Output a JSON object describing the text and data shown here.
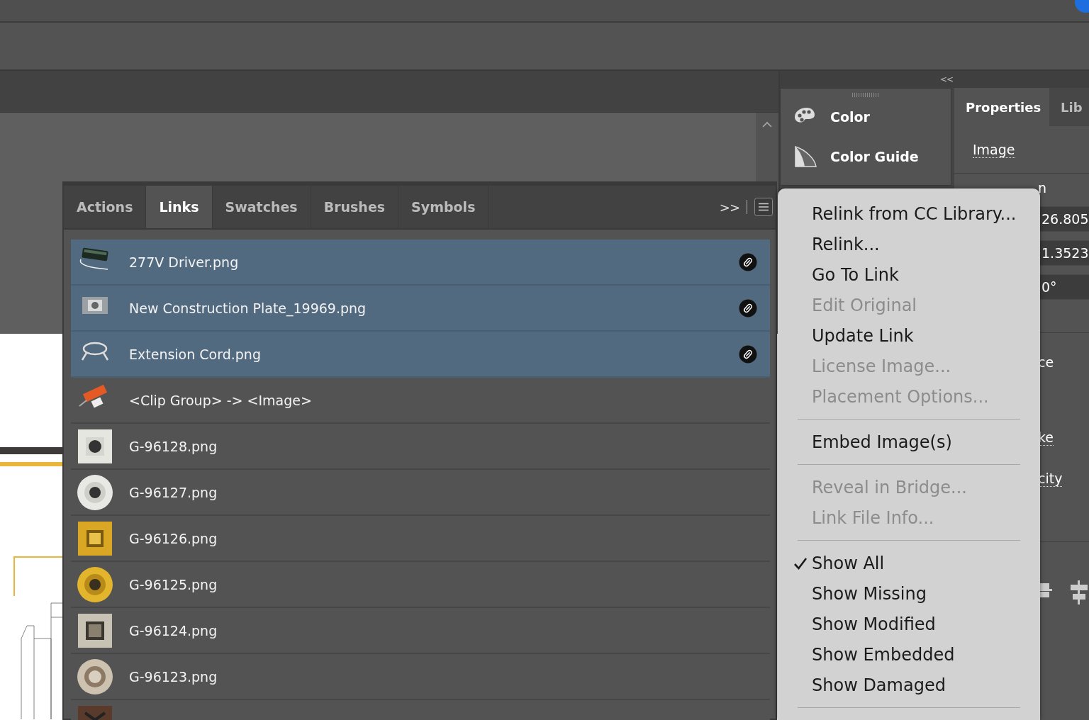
{
  "dock": {
    "collapse_label": "<<",
    "panels": [
      {
        "label": "Color"
      },
      {
        "label": "Color Guide"
      }
    ]
  },
  "properties": {
    "tabs": [
      {
        "label": "Properties",
        "selected": true
      },
      {
        "label": "Lib",
        "selected": false
      }
    ],
    "heading": "Image",
    "label_1": "n",
    "fields": [
      "26.805",
      "1.3523",
      "0°"
    ],
    "labels": [
      "ce",
      "ke",
      "city"
    ]
  },
  "links_panel": {
    "tabs": [
      {
        "label": "Actions",
        "selected": false
      },
      {
        "label": "Links",
        "selected": true
      },
      {
        "label": "Swatches",
        "selected": false
      },
      {
        "label": "Brushes",
        "selected": false
      },
      {
        "label": "Symbols",
        "selected": false
      }
    ],
    "overflow": ">>",
    "rows": [
      {
        "name": "277V Driver.png",
        "selected": true,
        "linked": true
      },
      {
        "name": "New Construction Plate_19969.png",
        "selected": true,
        "linked": true
      },
      {
        "name": "Extension Cord.png",
        "selected": true,
        "linked": true
      },
      {
        "name": "<Clip Group> -> <Image>",
        "selected": false,
        "linked": false
      },
      {
        "name": "G-96128.png",
        "selected": false,
        "linked": false
      },
      {
        "name": "G-96127.png",
        "selected": false,
        "linked": false
      },
      {
        "name": "G-96126.png",
        "selected": false,
        "linked": false
      },
      {
        "name": "G-96125.png",
        "selected": false,
        "linked": false
      },
      {
        "name": "G-96124.png",
        "selected": false,
        "linked": false
      },
      {
        "name": "G-96123.png",
        "selected": false,
        "linked": false
      },
      {
        "selected": false,
        "linked": false
      }
    ]
  },
  "menu": [
    {
      "kind": "item",
      "label": "Relink from CC Library...",
      "disabled": false,
      "checked": false
    },
    {
      "kind": "item",
      "label": "Relink...",
      "disabled": false,
      "checked": false
    },
    {
      "kind": "item",
      "label": "Go To Link",
      "disabled": false,
      "checked": false
    },
    {
      "kind": "item",
      "label": "Edit Original",
      "disabled": true,
      "checked": false
    },
    {
      "kind": "item",
      "label": "Update Link",
      "disabled": false,
      "checked": false
    },
    {
      "kind": "item",
      "label": "License Image...",
      "disabled": true,
      "checked": false
    },
    {
      "kind": "item",
      "label": "Placement Options...",
      "disabled": true,
      "checked": false
    },
    {
      "kind": "separator"
    },
    {
      "kind": "item",
      "label": "Embed Image(s)",
      "disabled": false,
      "checked": false
    },
    {
      "kind": "separator"
    },
    {
      "kind": "item",
      "label": "Reveal in Bridge...",
      "disabled": true,
      "checked": false
    },
    {
      "kind": "item",
      "label": "Link File Info...",
      "disabled": true,
      "checked": false
    },
    {
      "kind": "separator"
    },
    {
      "kind": "item",
      "label": "Show All",
      "disabled": false,
      "checked": true
    },
    {
      "kind": "item",
      "label": "Show Missing",
      "disabled": false,
      "checked": false
    },
    {
      "kind": "item",
      "label": "Show Modified",
      "disabled": false,
      "checked": false
    },
    {
      "kind": "item",
      "label": "Show Embedded",
      "disabled": false,
      "checked": false
    },
    {
      "kind": "item",
      "label": "Show Damaged",
      "disabled": false,
      "checked": false
    },
    {
      "kind": "separator"
    }
  ]
}
